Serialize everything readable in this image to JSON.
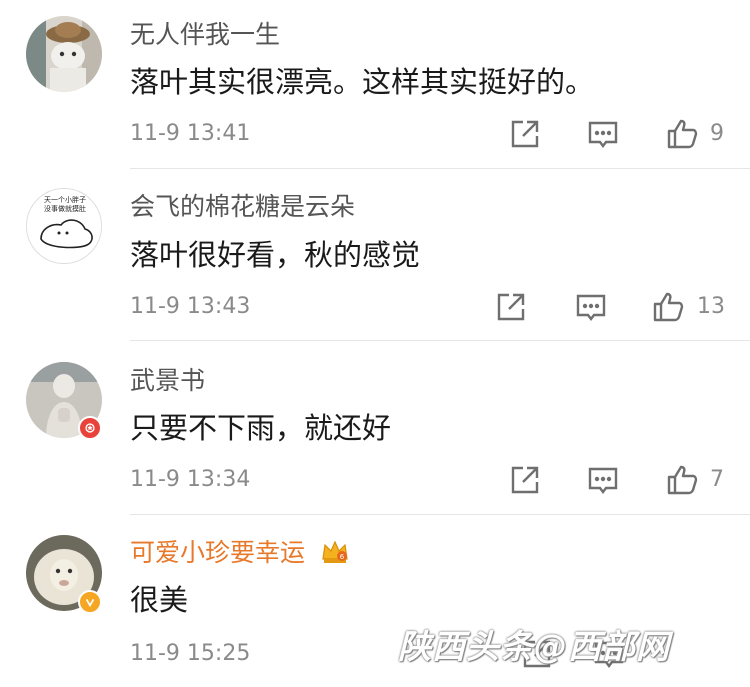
{
  "comments": [
    {
      "username": "无人伴我一生",
      "text": "落叶其实很漂亮。这样其实挺好的。",
      "time": "11-9 13:41",
      "likes": "9",
      "icons": [
        "share-icon",
        "comment-icon",
        "like-icon"
      ]
    },
    {
      "username": "会飞的棉花糖是云朵",
      "text": "落叶很好看，秋的感觉",
      "time": "11-9 13:43",
      "likes": "13",
      "icons": [
        "share-icon",
        "comment-icon",
        "like-icon"
      ]
    },
    {
      "username": "武景书",
      "text": "只要不下雨，就还好",
      "time": "11-9 13:34",
      "likes": "7",
      "icons": [
        "share-icon",
        "comment-icon",
        "like-icon"
      ]
    },
    {
      "username": "可爱小珍要幸运",
      "text": "很美",
      "time": "11-9 15:25",
      "likes": "",
      "icons": [
        "share-icon",
        "comment-icon"
      ]
    }
  ],
  "avatar_text": {
    "line1": "天一个小胖子",
    "line2": "没事做就摸肚"
  },
  "watermark": "陕西头条@西部网",
  "colors": {
    "vip_name": "#e8782a",
    "badge_red": "#e8433a",
    "badge_gold": "#f5a623",
    "text": "#1a1a1a",
    "meta": "#8a8a8a"
  }
}
